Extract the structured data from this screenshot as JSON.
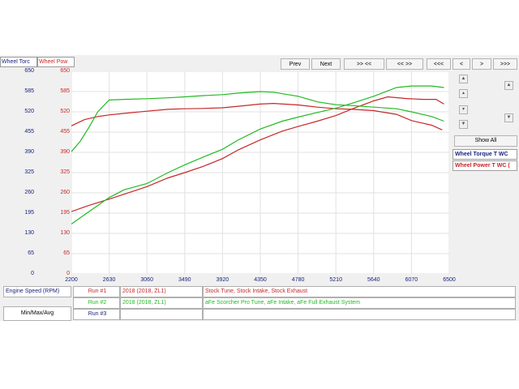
{
  "axis_headers": {
    "torque": "Wheel Torc",
    "power": "Wheel Pow"
  },
  "toolbar": {
    "prev": "Prev",
    "next": "Next",
    "b1": ">> <<",
    "b2": "<< >>",
    "b3": "<<<",
    "b4": "<",
    "b5": ">",
    "b6": ">>>"
  },
  "show_all": "Show All",
  "legend": {
    "torque": "Wheel Torque T WC",
    "power": "Wheel Power T WC ("
  },
  "bottom": {
    "x_axis_label": "Engine Speed (RPM)",
    "min_max": "Min/Max/Avg",
    "runs": [
      {
        "label": "Run #1",
        "vehicle": "2018 (2018, ZL1)",
        "description": "Stock Tune, Stock Intake, Stock Exhaust",
        "color": "#c62828"
      },
      {
        "label": "Run #2",
        "vehicle": "2018 (2018, ZL1)",
        "description": "aFe Scorcher Pro Tune, aFe Intake, aFe Full Exhaust System",
        "color": "#22bb22"
      },
      {
        "label": "Run #3",
        "vehicle": "",
        "description": "",
        "color": "#1a237e"
      }
    ]
  },
  "colors": {
    "torque_axis": "#1a237e",
    "power_axis": "#c62828",
    "run1": "#c62828",
    "run2": "#22bb22"
  },
  "chart_data": {
    "type": "line",
    "xlim": [
      2200,
      6500
    ],
    "ylim": [
      0,
      650
    ],
    "x_ticks": [
      "2200",
      "2630",
      "3060",
      "3490",
      "3920",
      "4350",
      "4780",
      "5210",
      "5640",
      "6070",
      "6500"
    ],
    "y_ticks_torque": [
      "0",
      "65",
      "130",
      "195",
      "260",
      "325",
      "390",
      "455",
      "520",
      "585",
      "650"
    ],
    "y_ticks_power": [
      "0",
      "65",
      "130",
      "195",
      "260",
      "325",
      "390",
      "455",
      "520",
      "585",
      "650"
    ],
    "series": [
      {
        "run": "Run #1",
        "quantity": "torque",
        "color": "#c62828",
        "x": [
          2200,
          2350,
          2500,
          2630,
          2800,
          3060,
          3300,
          3490,
          3700,
          3920,
          4100,
          4350,
          4500,
          4780,
          5000,
          5210,
          5400,
          5640,
          5900,
          6070,
          6300,
          6420
        ],
        "y": [
          475,
          495,
          505,
          510,
          515,
          522,
          528,
          530,
          531,
          533,
          538,
          545,
          547,
          542,
          535,
          530,
          528,
          524,
          512,
          492,
          477,
          462
        ]
      },
      {
        "run": "Run #1",
        "quantity": "power",
        "color": "#c62828",
        "x": [
          2200,
          2400,
          2630,
          2900,
          3060,
          3300,
          3490,
          3700,
          3920,
          4100,
          4350,
          4600,
          4780,
          5000,
          5210,
          5400,
          5640,
          5800,
          6000,
          6200,
          6350,
          6440
        ],
        "y": [
          200,
          220,
          240,
          265,
          280,
          308,
          325,
          345,
          370,
          398,
          430,
          458,
          473,
          490,
          508,
          530,
          555,
          568,
          563,
          560,
          560,
          545
        ]
      },
      {
        "run": "Run #2",
        "quantity": "torque",
        "color": "#22bb22",
        "x": [
          2200,
          2300,
          2400,
          2500,
          2630,
          2800,
          3060,
          3300,
          3490,
          3700,
          3920,
          4100,
          4350,
          4500,
          4780,
          5000,
          5210,
          5400,
          5640,
          5900,
          6070,
          6300,
          6440
        ],
        "y": [
          392,
          425,
          470,
          520,
          558,
          560,
          562,
          565,
          568,
          572,
          575,
          580,
          585,
          583,
          570,
          552,
          543,
          540,
          535,
          530,
          520,
          505,
          490
        ]
      },
      {
        "run": "Run #2",
        "quantity": "power",
        "color": "#22bb22",
        "x": [
          2200,
          2400,
          2630,
          2800,
          3060,
          3300,
          3490,
          3700,
          3920,
          4100,
          4350,
          4600,
          4780,
          5000,
          5210,
          5400,
          5640,
          5900,
          6070,
          6300,
          6440
        ],
        "y": [
          160,
          200,
          245,
          270,
          290,
          325,
          350,
          375,
          400,
          430,
          465,
          490,
          503,
          518,
          532,
          548,
          570,
          598,
          603,
          603,
          598
        ]
      }
    ]
  }
}
